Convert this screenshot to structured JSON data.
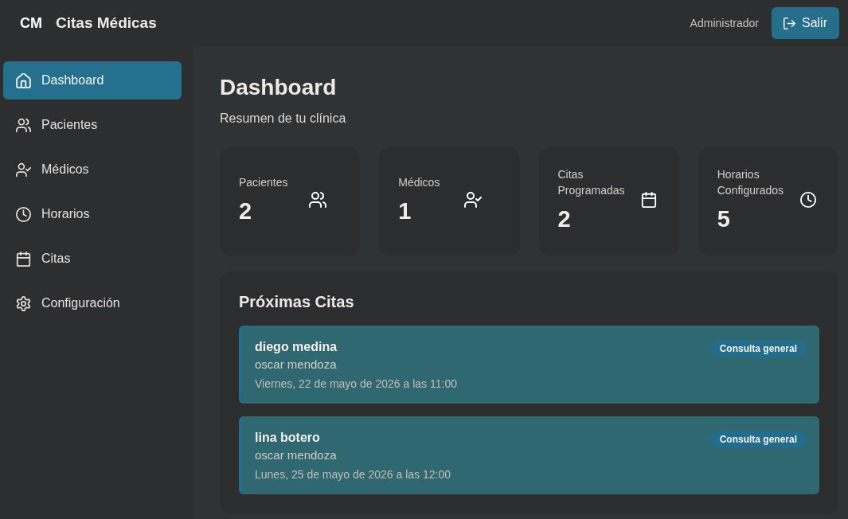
{
  "header": {
    "logo": "CM",
    "title": "Citas Médicas",
    "user": "Administrador",
    "logout_button": "Salir"
  },
  "sidebar": {
    "items": [
      {
        "label": "Dashboard",
        "selected": true
      },
      {
        "label": "Pacientes",
        "selected": false
      },
      {
        "label": "Médicos",
        "selected": false
      },
      {
        "label": "Horarios",
        "selected": false
      },
      {
        "label": "Citas",
        "selected": false
      },
      {
        "label": "Configuración",
        "selected": false
      }
    ]
  },
  "page": {
    "title": "Dashboard",
    "subtitle": "Resumen de tu clínica"
  },
  "stats": [
    {
      "label": "Pacientes",
      "value": "2"
    },
    {
      "label": "Médicos",
      "value": "1"
    },
    {
      "label": "Citas Programadas",
      "value": "2"
    },
    {
      "label": "Horarios Configurados",
      "value": "5"
    }
  ],
  "upcoming": {
    "title": "Próximas Citas",
    "items": [
      {
        "patient": "diego medina",
        "doctor": "oscar mendoza",
        "datetime": "Viernes, 22 de mayo de 2026 a las 11:00",
        "type": "Consulta general"
      },
      {
        "patient": "lina botero",
        "doctor": "oscar mendoza",
        "datetime": "Lunes, 25 de mayo de 2026 a las 12:00",
        "type": "Consulta general"
      }
    ]
  }
}
